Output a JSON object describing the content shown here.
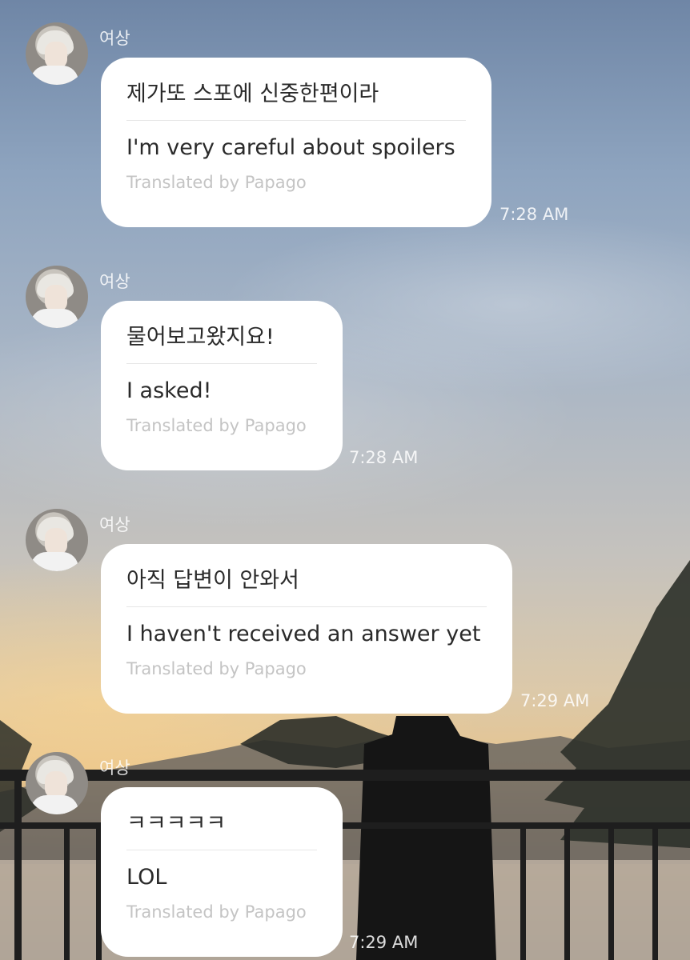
{
  "colors": {
    "bubble": "#ffffff",
    "text": "#2a2a2a",
    "muted": "#c4c4c4",
    "meta": "#ffffff"
  },
  "messages": [
    {
      "sender": "여상",
      "original": "제가또 스포에 신중한편이라",
      "translation": "I'm very careful about spoilers",
      "via": "Translated by Papago",
      "time": "7:28 AM"
    },
    {
      "sender": "여상",
      "original": "물어보고왔지요!",
      "translation": "I asked!",
      "via": "Translated by Papago",
      "time": "7:28 AM"
    },
    {
      "sender": "여상",
      "original": "아직 답변이 안와서",
      "translation": "I haven't received an answer yet",
      "via": "Translated by Papago",
      "time": "7:29 AM"
    },
    {
      "sender": "여상",
      "original": "ㅋㅋㅋㅋㅋ",
      "translation": "LOL",
      "via": "Translated by Papago",
      "time": "7:29 AM"
    }
  ]
}
